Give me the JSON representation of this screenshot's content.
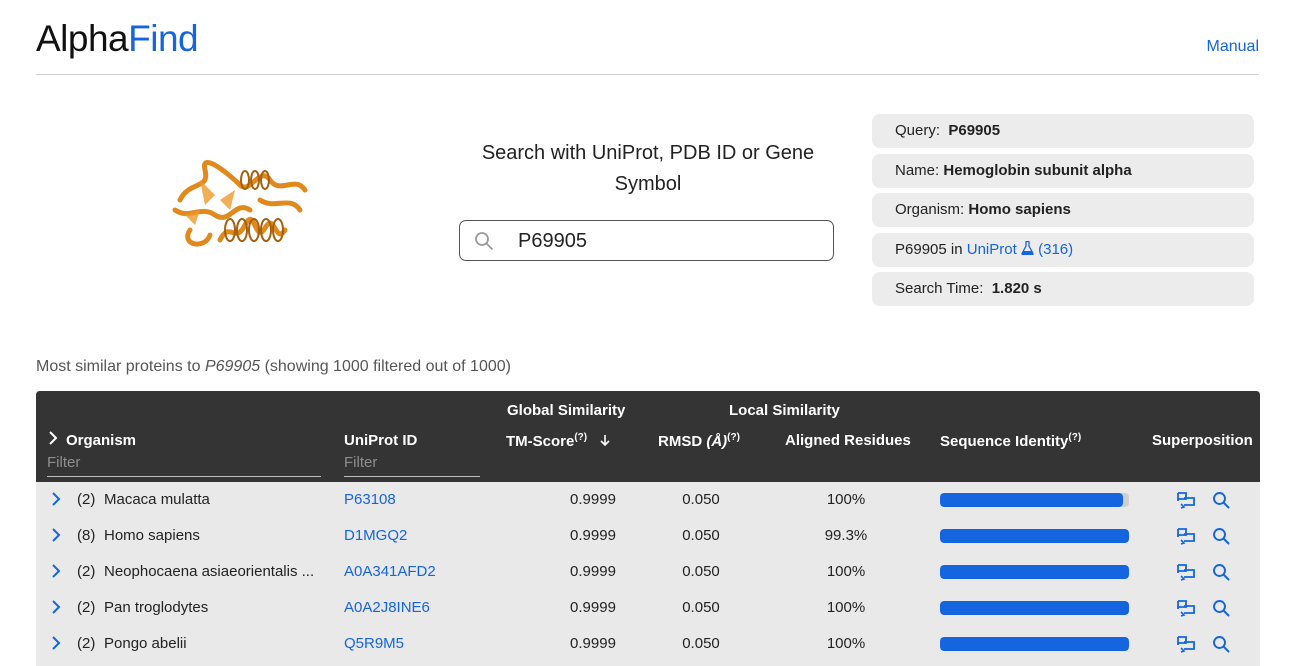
{
  "header": {
    "logo_part1": "Alpha",
    "logo_part2": "Find",
    "manual_link": "Manual"
  },
  "search": {
    "title": "Search with UniProt, PDB ID or Gene Symbol",
    "value": "P69905",
    "icon": "search-icon"
  },
  "info": {
    "query_label": "Query:",
    "query_value": "P69905",
    "name_label": "Name:",
    "name_value": "Hemoglobin subunit alpha",
    "organism_label": "Organism:",
    "organism_value": "Homo sapiens",
    "uniprot_prefix": "P69905 in",
    "uniprot_link": "UniProt",
    "uniprot_count": "(316)",
    "uniprot_icon": "flask-icon",
    "time_label": "Search Time:",
    "time_value": "1.820 s"
  },
  "summary": {
    "prefix": "Most similar proteins to",
    "query": "P69905",
    "suffix": "(showing 1000 filtered out of 1000)"
  },
  "table": {
    "group_global": "Global Similarity",
    "group_local": "Local Similarity",
    "col_organism": "Organism",
    "col_uniprot": "UniProt ID",
    "col_tm": "TM-Score",
    "col_rmsd": "RMSD",
    "col_rmsd_unit": "(Å)",
    "col_aligned": "Aligned Residues",
    "col_seqid": "Sequence Identity",
    "col_superposition": "Superposition",
    "help_mark": "(?)",
    "filter_placeholder": "Filter",
    "accent_color": "#1565e0",
    "rows": [
      {
        "count": "(2)",
        "organism": "Macaca mulatta",
        "uniprot": "P63108",
        "tm": "0.9999",
        "rmsd": "0.050",
        "aligned": "100%",
        "seq_identity": 0.97
      },
      {
        "count": "(8)",
        "organism": "Homo sapiens",
        "uniprot": "D1MGQ2",
        "tm": "0.9999",
        "rmsd": "0.050",
        "aligned": "99.3%",
        "seq_identity": 1.0
      },
      {
        "count": "(2)",
        "organism": "Neophocaena asiaeorientalis ...",
        "uniprot": "A0A341AFD2",
        "tm": "0.9999",
        "rmsd": "0.050",
        "aligned": "100%",
        "seq_identity": 1.0
      },
      {
        "count": "(2)",
        "organism": "Pan troglodytes",
        "uniprot": "A0A2J8INE6",
        "tm": "0.9999",
        "rmsd": "0.050",
        "aligned": "100%",
        "seq_identity": 1.0
      },
      {
        "count": "(2)",
        "organism": "Pongo abelii",
        "uniprot": "Q5R9M5",
        "tm": "0.9999",
        "rmsd": "0.050",
        "aligned": "100%",
        "seq_identity": 1.0
      }
    ]
  }
}
